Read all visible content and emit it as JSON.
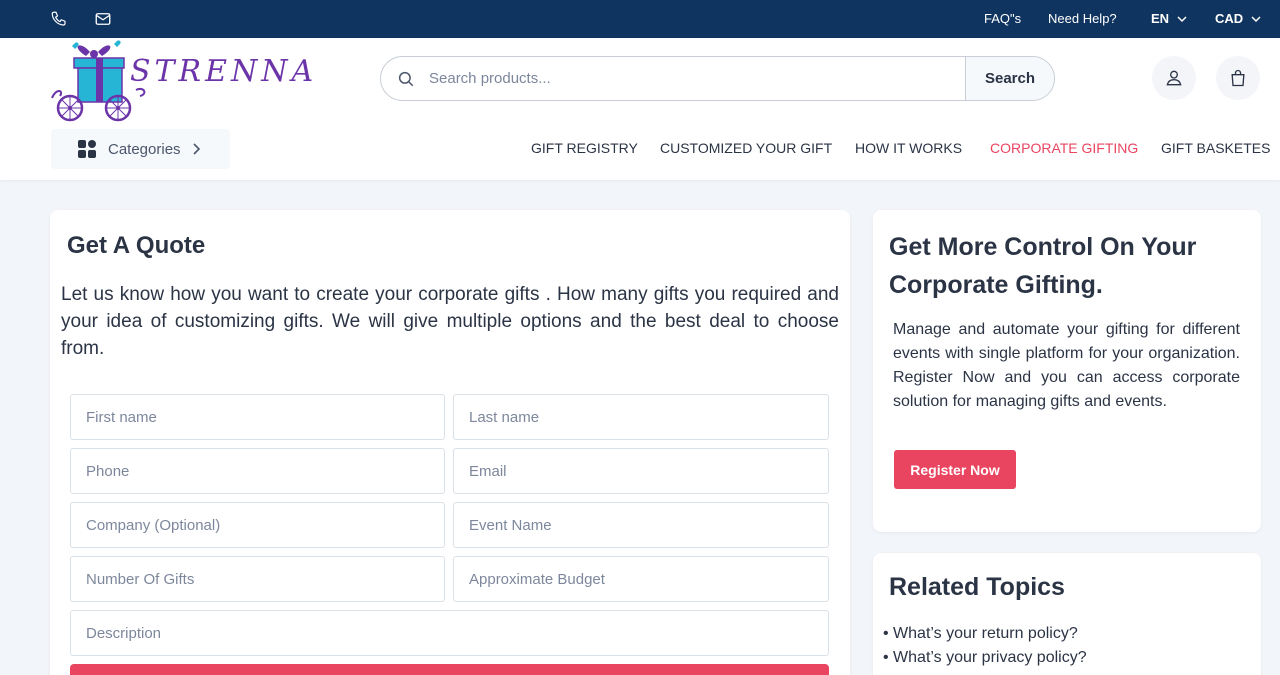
{
  "topbar": {
    "faq": "FAQ\"s",
    "help": "Need Help?",
    "language": "EN",
    "currency": "CAD"
  },
  "header": {
    "logo_text": "STRENNA",
    "search_placeholder": "Search products...",
    "search_button": "Search",
    "categories_label": "Categories",
    "nav": [
      {
        "label": "GIFT REGISTRY"
      },
      {
        "label": "CUSTOMIZED YOUR GIFT"
      },
      {
        "label": "HOW IT WORKS"
      },
      {
        "label": "CORPORATE GIFTING"
      },
      {
        "label": "GIFT BASKETES"
      }
    ]
  },
  "quote": {
    "title": "Get A Quote",
    "description": "Let us know how you want to create your corporate gifts . How many gifts you required and your idea of customizing gifts. We will give multiple options and the best deal to choose from.",
    "fields": {
      "first_name": "First name",
      "last_name": "Last name",
      "phone": "Phone",
      "email": "Email",
      "company": "Company (Optional)",
      "event_name": "Event Name",
      "number_of_gifts": "Number Of Gifts",
      "budget": "Approximate Budget",
      "description": "Description"
    }
  },
  "control": {
    "title": "Get More Control On Your Corporate Gifting.",
    "description": "Manage and automate your gifting for different events with single platform for your organization. Register Now and you can access corporate solution for managing gifts and events.",
    "register_button": "Register Now"
  },
  "related": {
    "title": "Related Topics",
    "items": [
      {
        "label": "• What’s your return policy?"
      },
      {
        "label": "• What’s your privacy policy?"
      }
    ]
  },
  "colors": {
    "topbar": "#0f3460",
    "accent": "#e94560",
    "logo": "#6b34a8",
    "gift_box": "#27b5d6"
  }
}
